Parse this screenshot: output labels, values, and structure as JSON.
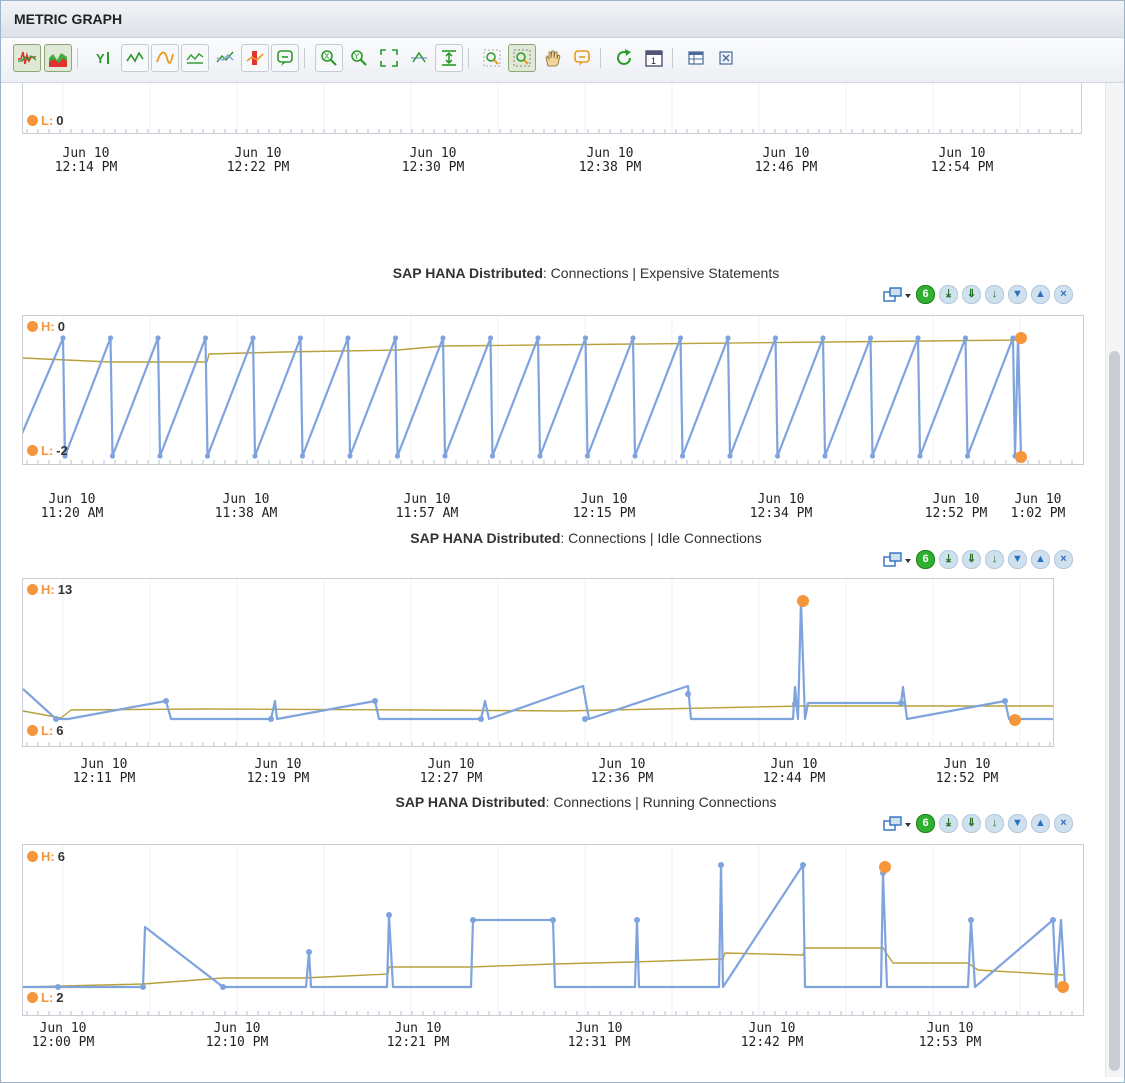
{
  "window": {
    "title": "METRIC GRAPH"
  },
  "toolbar": {
    "buttons": [
      {
        "icon": "line-chart-mode-icon",
        "on": true
      },
      {
        "icon": "area-chart-mode-icon",
        "on": true
      },
      {
        "icon": "y-axis-icon",
        "on": false
      },
      {
        "icon": "line-series-icon",
        "on": false
      },
      {
        "icon": "curve-series-icon",
        "on": false
      },
      {
        "icon": "step-series-icon",
        "on": false
      },
      {
        "icon": "band-series-icon",
        "on": false
      },
      {
        "icon": "threshold-icon",
        "on": false
      },
      {
        "icon": "annotation-icon",
        "on": false
      },
      {
        "icon": "zoom-x-icon",
        "on": false
      },
      {
        "icon": "zoom-y-icon",
        "on": false
      },
      {
        "icon": "fit-all-icon",
        "on": false
      },
      {
        "icon": "baseline-icon",
        "on": false
      },
      {
        "icon": "compare-icon",
        "on": false
      },
      {
        "icon": "zoom-in-icon",
        "on": false
      },
      {
        "icon": "zoom-box-icon",
        "on": true
      },
      {
        "icon": "pan-hand-icon",
        "on": false
      },
      {
        "icon": "comment-icon",
        "on": false
      },
      {
        "icon": "refresh-icon",
        "on": false
      },
      {
        "icon": "calendar-icon",
        "on": false
      },
      {
        "icon": "table-view-icon",
        "on": false
      },
      {
        "icon": "close-panel-icon",
        "on": false
      }
    ],
    "calendar_day": "1"
  },
  "charts": [
    {
      "title_bold": "",
      "title_rest": "",
      "high_label": "",
      "low_label": "L:",
      "low_value": "0",
      "ticks": [
        {
          "day": "Jun 10",
          "time": "12:14 PM"
        },
        {
          "day": "Jun 10",
          "time": "12:22 PM"
        },
        {
          "day": "Jun 10",
          "time": "12:30 PM"
        },
        {
          "day": "Jun 10",
          "time": "12:38 PM"
        },
        {
          "day": "Jun 10",
          "time": "12:46 PM"
        },
        {
          "day": "Jun 10",
          "time": "12:54 PM"
        }
      ]
    },
    {
      "title_bold": "SAP HANA Distributed",
      "title_rest": "Connections | Expensive Statements",
      "high_label": "H:",
      "high_value": "0",
      "low_label": "L:",
      "low_value": "-2",
      "ticks": [
        {
          "day": "Jun 10",
          "time": "11:20 AM"
        },
        {
          "day": "Jun 10",
          "time": "11:38 AM"
        },
        {
          "day": "Jun 10",
          "time": "11:57 AM"
        },
        {
          "day": "Jun 10",
          "time": "12:15 PM"
        },
        {
          "day": "Jun 10",
          "time": "12:34 PM"
        },
        {
          "day": "Jun 10",
          "time": "12:52 PM"
        },
        {
          "day": "Jun 10",
          "time": "1:02 PM"
        }
      ]
    },
    {
      "title_bold": "SAP HANA Distributed",
      "title_rest": "Connections | Idle Connections",
      "high_label": "H:",
      "high_value": "13",
      "low_label": "L:",
      "low_value": "6",
      "ticks": [
        {
          "day": "Jun 10",
          "time": "12:11 PM"
        },
        {
          "day": "Jun 10",
          "time": "12:19 PM"
        },
        {
          "day": "Jun 10",
          "time": "12:27 PM"
        },
        {
          "day": "Jun 10",
          "time": "12:36 PM"
        },
        {
          "day": "Jun 10",
          "time": "12:44 PM"
        },
        {
          "day": "Jun 10",
          "time": "12:52 PM"
        }
      ]
    },
    {
      "title_bold": "SAP HANA Distributed",
      "title_rest": "Connections | Running Connections",
      "high_label": "H:",
      "high_value": "6",
      "low_label": "L:",
      "low_value": "2",
      "ticks": [
        {
          "day": "Jun 10",
          "time": "12:00 PM"
        },
        {
          "day": "Jun 10",
          "time": "12:10 PM"
        },
        {
          "day": "Jun 10",
          "time": "12:21 PM"
        },
        {
          "day": "Jun 10",
          "time": "12:31 PM"
        },
        {
          "day": "Jun 10",
          "time": "12:42 PM"
        },
        {
          "day": "Jun 10",
          "time": "12:53 PM"
        }
      ]
    }
  ],
  "chart_actions": {
    "green_badge": "6",
    "icons": [
      "popout-menu-icon",
      "status-badge",
      "download-csv-icon",
      "save-icon",
      "download-icon",
      "move-down-icon",
      "move-up-icon",
      "remove-chart-icon"
    ]
  },
  "colors": {
    "series": "#7fa3dd",
    "baseline": "#b8a03a",
    "marker": "#f7953a",
    "accent_green": "#2fb12f"
  }
}
